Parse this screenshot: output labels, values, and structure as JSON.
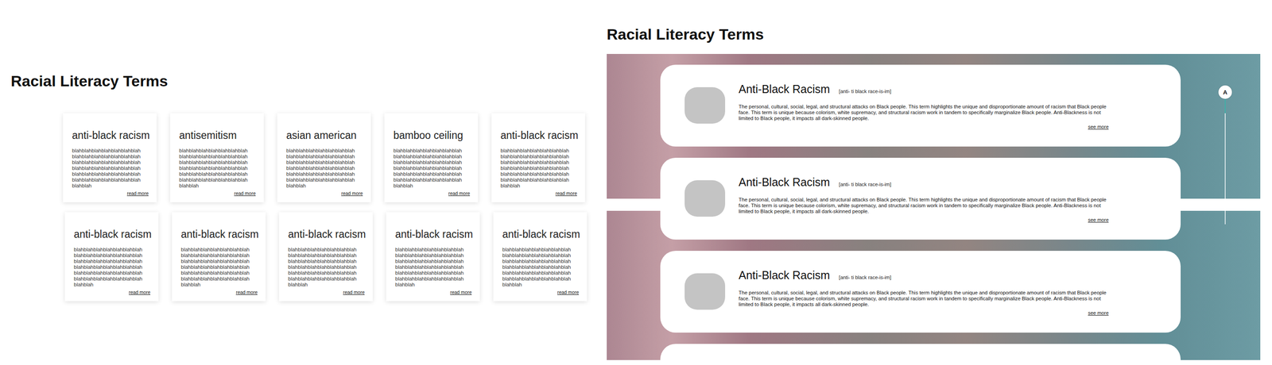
{
  "left": {
    "title": "Racial Literacy Terms",
    "rows": [
      [
        {
          "term": "anti-black racism",
          "body": "blahblahblahblahblahblahblahblahblahblahblahblahblahblahblahblahblahblahblahblahblahblahblahblahblahblahblahblahblahblahblahblahblahblahblahblahblahblahblahblahblahblahblahblah",
          "link": "read more"
        },
        {
          "term": "antisemitism",
          "body": "blahblahblahblahblahblahblahblahblahblahblahblahblahblahblahblahblahblahblahblahblahblahblahblahblahblahblahblahblahblahblahblahblahblahblahblahblahblahblahblahblahblahblahblah",
          "link": "read more"
        },
        {
          "term": "asian american",
          "body": "blahblahblahblahblahblahblahblahblahblahblahblahblahblahblahblahblahblahblahblahblahblahblahblahblahblahblahblahblahblahblahblahblahblahblahblahblahblahblahblahblahblahblahblah",
          "link": "read more"
        },
        {
          "term": "bamboo ceiling",
          "body": "blahblahblahblahblahblahblahblahblahblahblahblahblahblahblahblahblahblahblahblahblahblahblahblahblahblahblahblahblahblahblahblahblahblahblahblahblahblahblahblahblahblahblahblah",
          "link": "read more"
        },
        {
          "term": "anti-black racism",
          "body": "blahblahblahblahblahblahblahblahblahblahblahblahblahblahblahblahblahblahblahblahblahblahblahblahblahblahblahblahblahblahblahblahblahblahblahblahblahblahblahblahblahblahblahblah",
          "link": "read more"
        }
      ],
      [
        {
          "term": "anti-black racism",
          "body": "blahblahblahblahblahblahblahblahblahblahblahblahblahblahblahblahblahblahblahblahblahblahblahblahblahblahblahblahblahblahblahblahblahblahblahblahblahblahblahblahblahblahblahblah",
          "link": "read more"
        },
        {
          "term": "anti-black racism",
          "body": "blahblahblahblahblahblahblahblahblahblahblahblahblahblahblahblahblahblahblahblahblahblahblahblahblahblahblahblahblahblahblahblahblahblahblahblahblahblahblahblahblahblahblahblah",
          "link": "read more"
        },
        {
          "term": "anti-black racism",
          "body": "blahblahblahblahblahblahblahblahblahblahblahblahblahblahblahblahblahblahblahblahblahblahblahblahblahblahblahblahblahblahblahblahblahblahblahblahblahblahblahblahblahblahblahblah",
          "link": "read more"
        },
        {
          "term": "anti-black racism",
          "body": "blahblahblahblahblahblahblahblahblahblahblahblahblahblahblahblahblahblahblahblahblahblahblahblahblahblahblahblahblahblahblahblahblahblahblahblahblahblahblahblahblahblahblahblah",
          "link": "read more"
        },
        {
          "term": "anti-black racism",
          "body": "blahblahblahblahblahblahblahblahblahblahblahblahblahblahblahblahblahblahblahblahblahblahblahblahblahblahblahblahblahblahblahblahblahblahblahblahblahblahblahblahblahblahblahblah",
          "link": "read more"
        }
      ]
    ]
  },
  "right": {
    "title": "Racial Literacy Terms",
    "entries": [
      {
        "term": "Anti-Black Racism",
        "pronunciation": "[anti- ti black race-is-im]",
        "definition": "The personal, cultural, social, legal, and structural attacks on Black people. This term highlights the unique and disproportionate amount of racism that Black people face. This term is unique because colorism, white supremacy, and structural racism work in tandem to specifically marginalize Black people. Anti-Blackness is not limited to Black people, it impacts all dark-skinned people.",
        "link": "see more"
      },
      {
        "term": "Anti-Black Racism",
        "pronunciation": "[anti- ti black race-is-im]",
        "definition": "The personal, cultural, social, legal, and structural attacks on Black people. This term highlights the unique and disproportionate amount of racism that Black people face. This term is unique because colorism, white supremacy, and structural racism work in tandem to specifically marginalize Black people. Anti-Blackness is not limited to Black people, it impacts all dark-skinned people.",
        "link": "see more"
      },
      {
        "term": "Anti-Black Racism",
        "pronunciation": "[anti- ti black race-is-im]",
        "definition": "The personal, cultural, social, legal, and structural attacks on Black people. This term highlights the unique and disproportionate amount of racism that Black people face. This term is unique because colorism, white supremacy, and structural racism work in tandem to specifically marginalize Black people. Anti-Blackness is not limited to Black people, it impacts all dark-skinned people.",
        "link": "see more"
      }
    ],
    "index": {
      "letter": "A"
    }
  }
}
